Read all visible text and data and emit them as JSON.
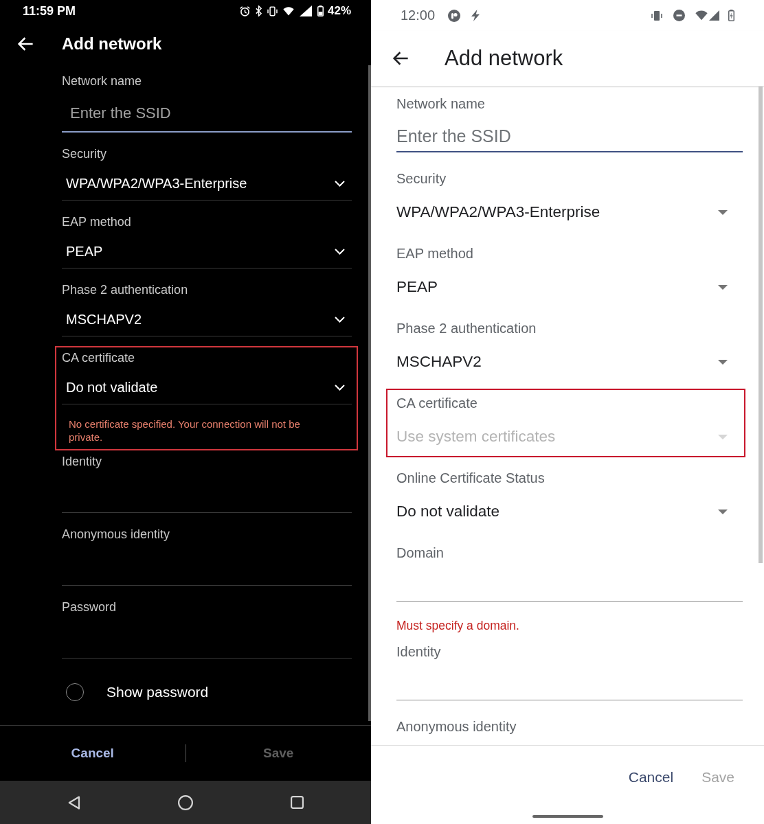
{
  "panels": [
    {
      "kind": "dark",
      "status_bar": {
        "time": "11:59 PM",
        "battery": "42%"
      },
      "title": "Add network",
      "fields": [
        {
          "kind": "text",
          "label": "Network name",
          "placeholder": "Enter the SSID",
          "focused": true,
          "highlighted": false
        },
        {
          "kind": "dropdown",
          "label": "Security",
          "value": "WPA/WPA2/WPA3-Enterprise",
          "highlighted": false
        },
        {
          "kind": "dropdown",
          "label": "EAP method",
          "value": "PEAP",
          "highlighted": false
        },
        {
          "kind": "dropdown",
          "label": "Phase 2 authentication",
          "value": "MSCHAPV2",
          "highlighted": false
        },
        {
          "kind": "dropdown",
          "label": "CA certificate",
          "value": "Do not validate",
          "error": "No certificate specified. Your connection will not be private.",
          "highlighted": true
        },
        {
          "kind": "text",
          "label": "Identity",
          "focused": false,
          "highlighted": false
        },
        {
          "kind": "text",
          "label": "Anonymous identity",
          "focused": false,
          "highlighted": false
        },
        {
          "kind": "text",
          "label": "Password",
          "focused": false,
          "highlighted": false
        },
        {
          "kind": "checkbox",
          "label": "Show password",
          "checked": false,
          "highlighted": false
        }
      ],
      "buttons": [
        {
          "label": "Cancel",
          "disabled": false
        },
        {
          "label": "Save",
          "disabled": true
        }
      ]
    },
    {
      "kind": "light",
      "status_bar": {
        "time": "12:00"
      },
      "title": "Add network",
      "fields": [
        {
          "kind": "text",
          "label": "Network name",
          "placeholder": "Enter the SSID",
          "focused": true,
          "highlighted": false
        },
        {
          "kind": "dropdown",
          "label": "Security",
          "value": "WPA/WPA2/WPA3-Enterprise",
          "disabled": false,
          "highlighted": false
        },
        {
          "kind": "dropdown",
          "label": "EAP method",
          "value": "PEAP",
          "disabled": false,
          "highlighted": false
        },
        {
          "kind": "dropdown",
          "label": "Phase 2 authentication",
          "value": "MSCHAPV2",
          "disabled": false,
          "highlighted": false
        },
        {
          "kind": "dropdown",
          "label": "CA certificate",
          "value": "Use system certificates",
          "disabled": true,
          "highlighted": true
        },
        {
          "kind": "dropdown",
          "label": "Online Certificate Status",
          "value": "Do not validate",
          "disabled": false,
          "highlighted": false
        },
        {
          "kind": "text",
          "label": "Domain",
          "focused": false,
          "error": "Must specify a domain.",
          "highlighted": false
        },
        {
          "kind": "text",
          "label": "Identity",
          "focused": false,
          "highlighted": false
        },
        {
          "kind": "label",
          "label": "Anonymous identity",
          "highlighted": false
        }
      ],
      "buttons": [
        {
          "label": "Cancel",
          "disabled": false
        },
        {
          "label": "Save",
          "disabled": true
        }
      ]
    }
  ]
}
